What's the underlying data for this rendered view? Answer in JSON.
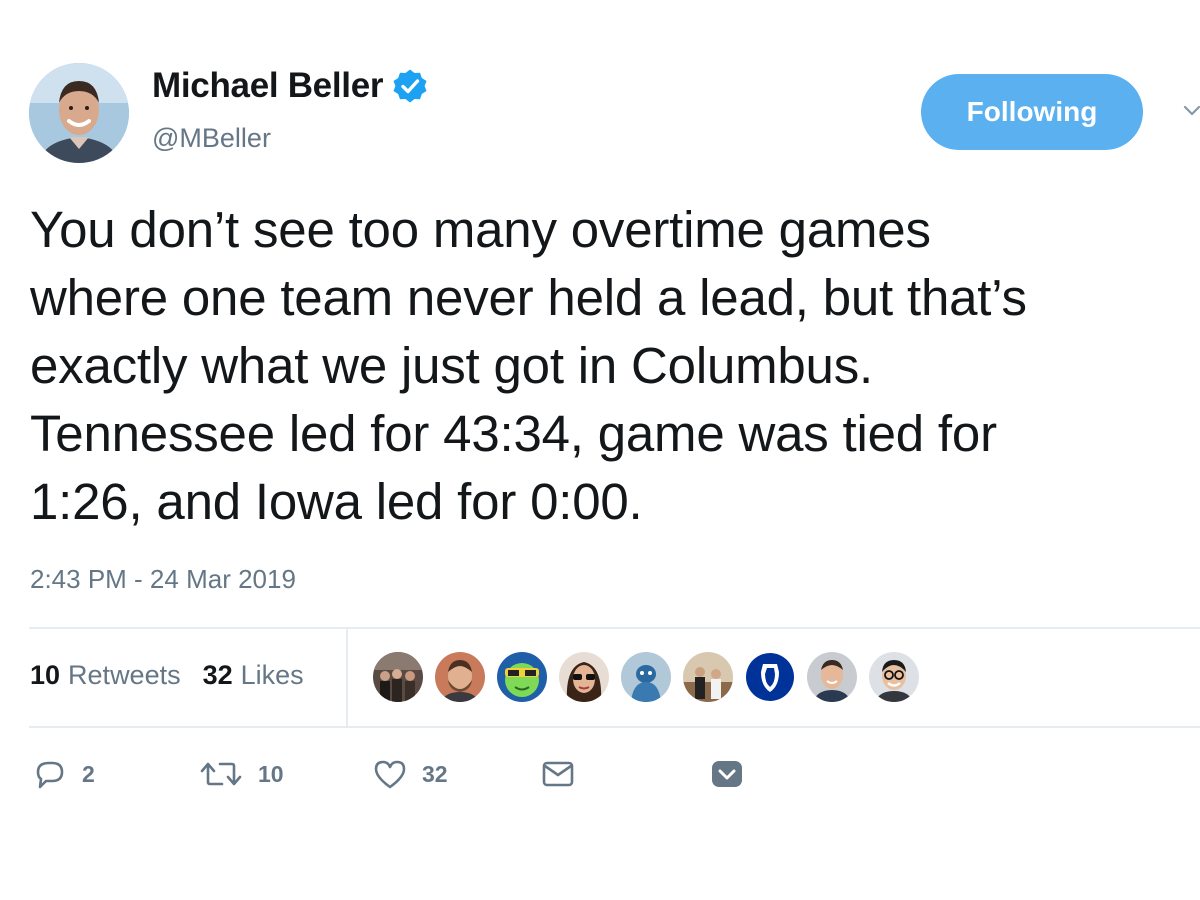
{
  "author": {
    "name": "Michael Beller",
    "handle": "@MBeller",
    "verified": true,
    "verified_color": "#1da1f2",
    "avatar_icon": "person-avatar-icon"
  },
  "follow_button": {
    "label": "Following",
    "color": "#5bb0ef"
  },
  "tweet": {
    "text": "You don’t see too many overtime games\nwhere one team never held a lead, but that’s\nexactly what we just got in Columbus.\nTennessee led for 43:34, game was tied for\n1:26, and Iowa led for 0:00.",
    "timestamp": "2:43 PM - 24 Mar 2019"
  },
  "stats": {
    "retweets_count": "10",
    "retweets_label": "Retweets",
    "likes_count": "32",
    "likes_label": "Likes"
  },
  "likers": [
    {
      "icon": "liker-avatar-group-photo"
    },
    {
      "icon": "liker-avatar-man-bearded"
    },
    {
      "icon": "liker-avatar-cartoon-sunglasses"
    },
    {
      "icon": "liker-avatar-woman-sunglasses"
    },
    {
      "icon": "liker-avatar-mascot"
    },
    {
      "icon": "liker-avatar-people-indoors"
    },
    {
      "icon": "liker-avatar-duke-logo"
    },
    {
      "icon": "liker-avatar-man-smiling"
    },
    {
      "icon": "liker-avatar-man-glasses"
    }
  ],
  "actions": {
    "reply_count": "2",
    "retweet_count": "10",
    "like_count": "32"
  },
  "colors": {
    "text": "#14171a",
    "secondary": "#657786",
    "divider": "#e6ecf0",
    "action_icon": "#657786"
  }
}
